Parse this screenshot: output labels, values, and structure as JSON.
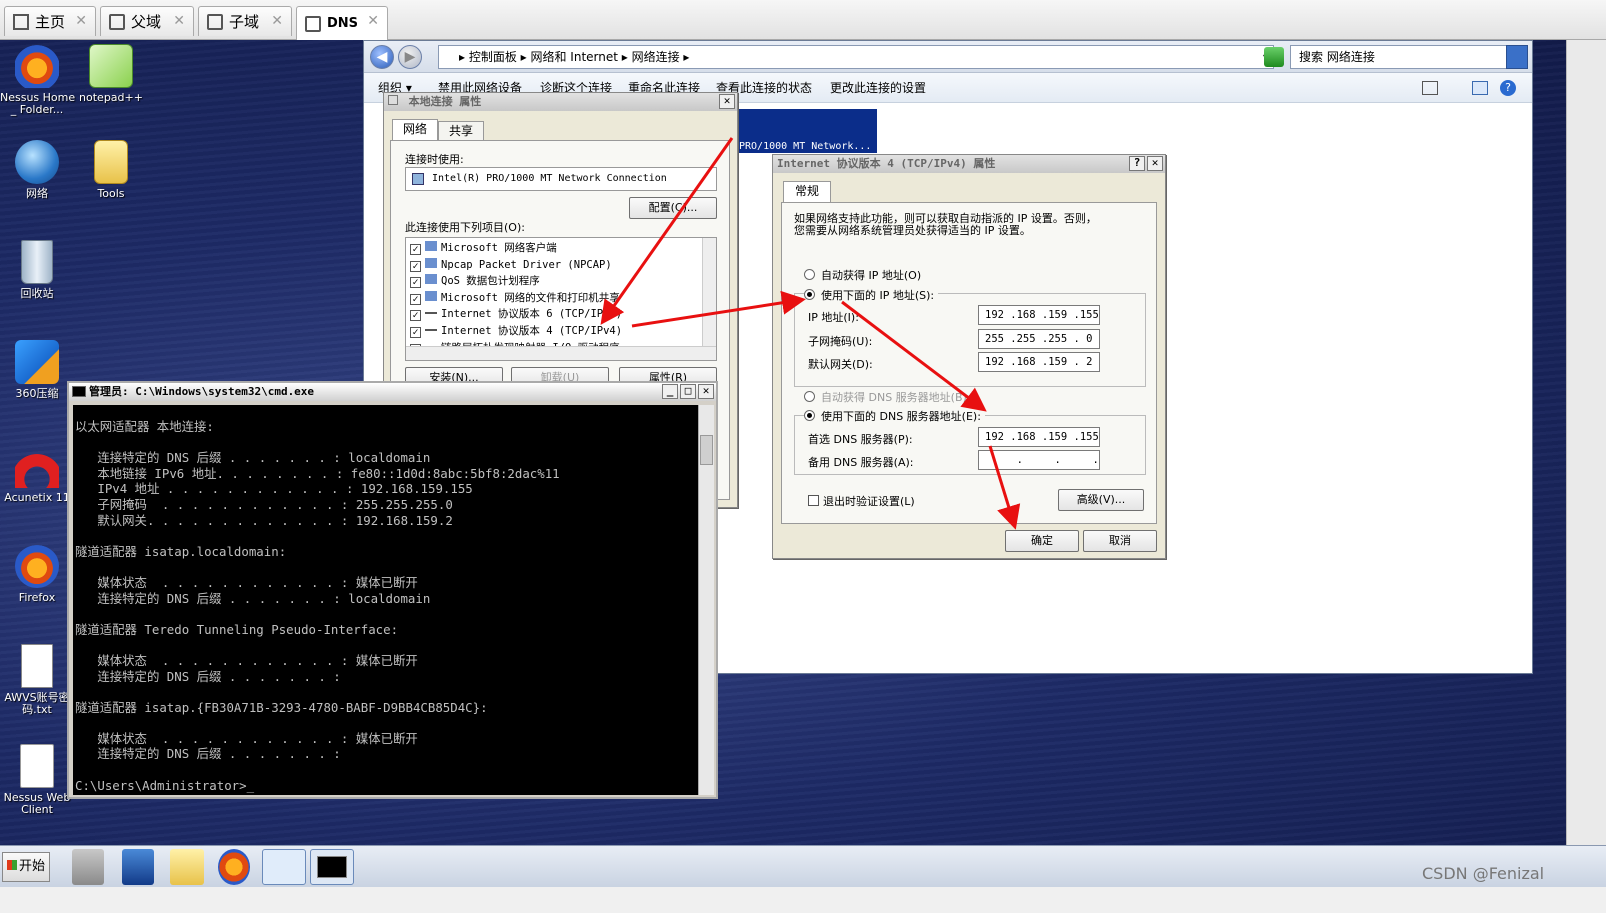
{
  "vm_tabs": [
    {
      "label": "主页",
      "icon": "home-icon"
    },
    {
      "label": "父域",
      "icon": "vm-icon"
    },
    {
      "label": "子域",
      "icon": "vm-icon"
    },
    {
      "label": "DNS",
      "icon": "vm-icon"
    }
  ],
  "desktop_icons": [
    {
      "label": "Nessus Home\n_ Folder...",
      "icon": "firefox-icon"
    },
    {
      "label": "notepad++",
      "icon": "notepad-plus-plus-icon"
    },
    {
      "label": "网络",
      "icon": "network-globe-icon"
    },
    {
      "label": "Tools",
      "icon": "folder-icon"
    },
    {
      "label": "回收站",
      "icon": "recycle-bin-icon"
    },
    {
      "label": "360压缩",
      "icon": "archive-icon"
    },
    {
      "label": "Acunetix 11",
      "icon": "acunetix-icon"
    },
    {
      "label": "Firefox",
      "icon": "firefox-icon"
    },
    {
      "label": "AWVS账号密\n码.txt",
      "icon": "text-file-icon"
    },
    {
      "label": "Nessus Web\nClient",
      "icon": "firefox-icon"
    }
  ],
  "explorer": {
    "breadcrumb": "▸ 控制面板 ▸ 网络和 Internet ▸ 网络连接 ▸",
    "search_placeholder": "搜索 网络连接",
    "commands": [
      "组织 ▾",
      "禁用此网络设备",
      "诊断这个连接",
      "重命名此连接",
      "查看此连接的状态",
      "更改此连接的设置"
    ],
    "adapter_label": "PRO/1000 MT Network..."
  },
  "local_conn": {
    "title": "本地连接 属性",
    "tabs": [
      "网络",
      "共享"
    ],
    "connect_using_label": "连接时使用:",
    "adapter": "Intel(R) PRO/1000 MT Network Connection",
    "configure_button": "配置(C)...",
    "items_label": "此连接使用下列项目(O):",
    "items": [
      "Microsoft 网络客户端",
      "Npcap Packet Driver (NPCAP)",
      "QoS 数据包计划程序",
      "Microsoft 网络的文件和打印机共享",
      "Internet 协议版本 6 (TCP/IPv6)",
      "Internet 协议版本 4 (TCP/IPv4)",
      "链路层拓扑发现映射器 I/O 驱动程序"
    ],
    "install_button": "安装(N)...",
    "uninstall_button": "卸载(U)",
    "properties_button": "属性(R)"
  },
  "ipv4": {
    "title": "Internet 协议版本 4 (TCP/IPv4) 属性",
    "tab": "常规",
    "description": "如果网络支持此功能，则可以获取自动指派的 IP 设置。否则，\n您需要从网络系统管理员处获得适当的 IP 设置。",
    "auto_ip": "自动获得 IP 地址(O)",
    "manual_ip": "使用下面的 IP 地址(S):",
    "ip_label": "IP 地址(I):",
    "ip_value": "192 .168 .159 .155",
    "mask_label": "子网掩码(U):",
    "mask_value": "255 .255 .255 . 0",
    "gateway_label": "默认网关(D):",
    "gateway_value": "192 .168 .159 . 2",
    "auto_dns": "自动获得 DNS 服务器地址(B)",
    "manual_dns": "使用下面的 DNS 服务器地址(E):",
    "preferred_dns_label": "首选 DNS 服务器(P):",
    "preferred_dns_value": "192 .168 .159 .155",
    "alternate_dns_label": "备用 DNS 服务器(A):",
    "alternate_dns_value": "     .     .     .",
    "validate_label": "退出时验证设置(L)",
    "advanced_button": "高级(V)...",
    "ok_button": "确定",
    "cancel_button": "取消"
  },
  "cmd": {
    "title": "管理员: C:\\Windows\\system32\\cmd.exe",
    "output": "以太网适配器 本地连接:\n\n   连接特定的 DNS 后缀 . . . . . . . : localdomain\n   本地链接 IPv6 地址. . . . . . . . : fe80::1d0d:8abc:5bf8:2dac%11\n   IPv4 地址 . . . . . . . . . . . . : 192.168.159.155\n   子网掩码  . . . . . . . . . . . . : 255.255.255.0\n   默认网关. . . . . . . . . . . . . : 192.168.159.2\n\n隧道适配器 isatap.localdomain:\n\n   媒体状态  . . . . . . . . . . . . : 媒体已断开\n   连接特定的 DNS 后缀 . . . . . . . : localdomain\n\n隧道适配器 Teredo Tunneling Pseudo-Interface:\n\n   媒体状态  . . . . . . . . . . . . : 媒体已断开\n   连接特定的 DNS 后缀 . . . . . . . :\n\n隧道适配器 isatap.{FB30A71B-3293-4780-BABF-D9BB4CB85D4C}:\n\n   媒体状态  . . . . . . . . . . . . : 媒体已断开\n   连接特定的 DNS 后缀 . . . . . . . :\n\nC:\\Users\\Administrator>_"
  },
  "taskbar": {
    "start_label": "开始",
    "items": [
      "server-manager-icon",
      "powershell-icon",
      "explorer-folder-icon",
      "firefox-icon",
      "network-connections-icon",
      "cmd-icon"
    ]
  },
  "watermark": "CSDN @Fenizal",
  "annotation_color": "#e81010"
}
